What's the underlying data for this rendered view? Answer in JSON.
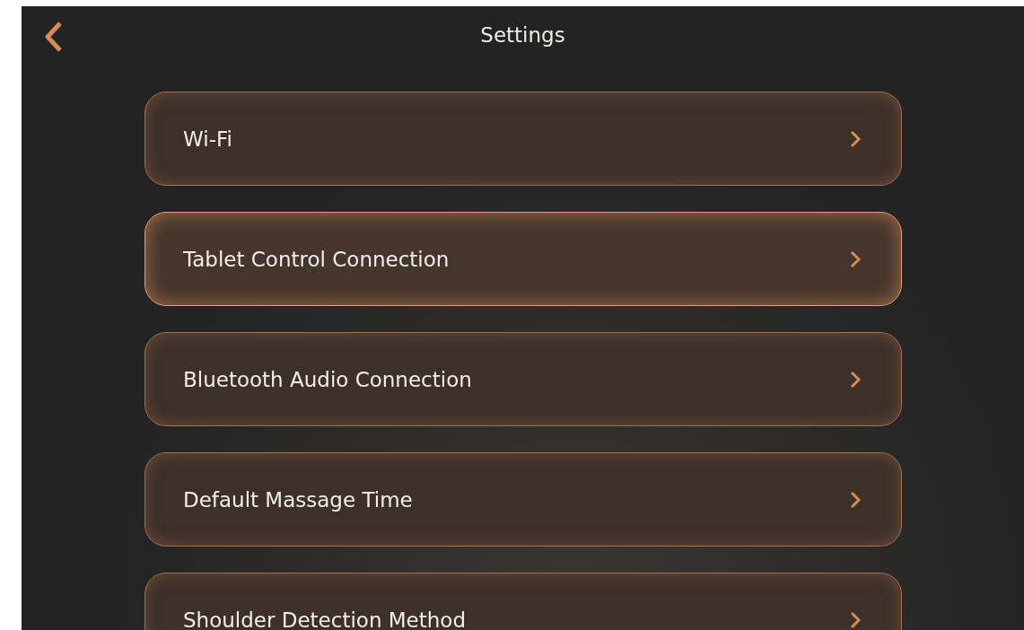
{
  "header": {
    "title": "Settings"
  },
  "items": [
    {
      "label": "Wi-Fi",
      "selected": false
    },
    {
      "label": "Tablet Control Connection",
      "selected": true
    },
    {
      "label": "Bluetooth Audio Connection",
      "selected": false
    },
    {
      "label": "Default Massage Time",
      "selected": false
    },
    {
      "label": "Shoulder Detection Method",
      "selected": false
    }
  ]
}
